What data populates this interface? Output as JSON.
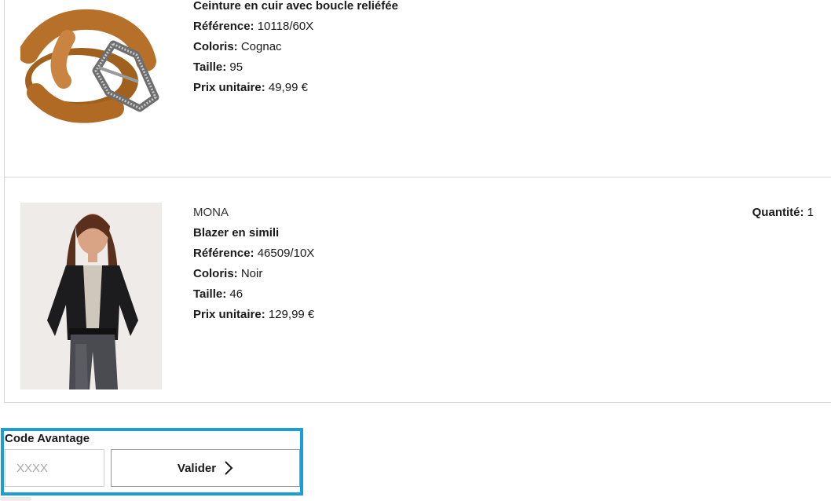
{
  "products": [
    {
      "brand": "",
      "title": "Ceinture en cuir avec boucle reliéfée",
      "ref_label": "Référence:",
      "ref_value": "10118/60X",
      "color_label": "Coloris:",
      "color_value": "Cognac",
      "size_label": "Taille:",
      "size_value": "95",
      "price_label": "Prix unitaire:",
      "price_value": "49,99 €",
      "image_icon": "belt-image"
    },
    {
      "brand": "MONA",
      "title": "Blazer en simili",
      "ref_label": "Référence:",
      "ref_value": "46509/10X",
      "color_label": "Coloris:",
      "color_value": "Noir",
      "size_label": "Taille:",
      "size_value": "46",
      "price_label": "Prix unitaire:",
      "price_value": "129,99 €",
      "qty_label": "Quantité:",
      "qty_value": "1",
      "image_icon": "blazer-model-image"
    }
  ],
  "coupon": {
    "label": "Code Avantage",
    "placeholder": "XXXX",
    "button_label": "Valider",
    "highlight_color": "#1a9ed8"
  }
}
